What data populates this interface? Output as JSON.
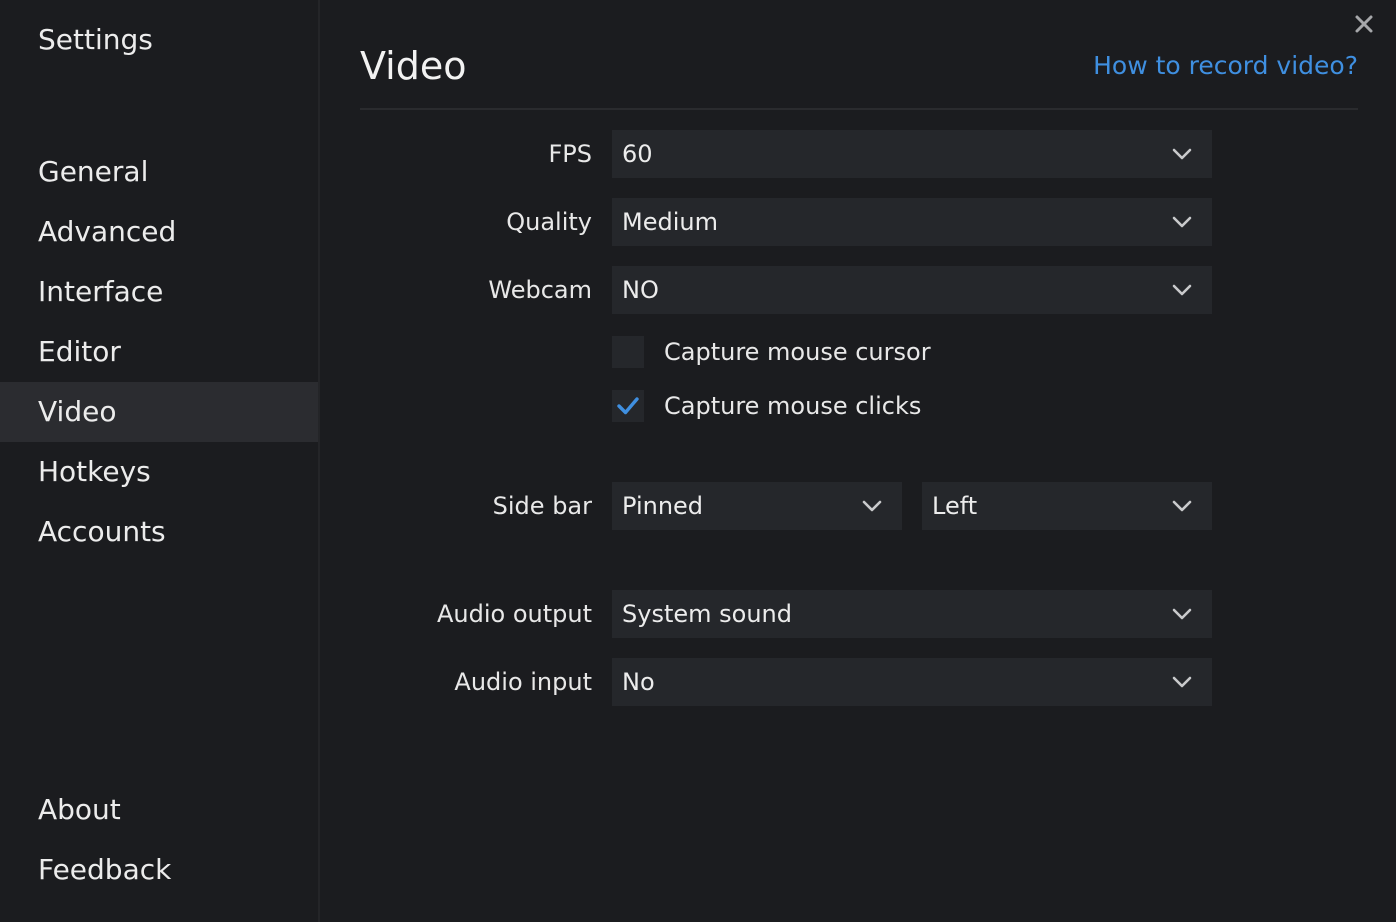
{
  "sidebar": {
    "title": "Settings",
    "items": [
      {
        "label": "General",
        "active": false
      },
      {
        "label": "Advanced",
        "active": false
      },
      {
        "label": "Interface",
        "active": false
      },
      {
        "label": "Editor",
        "active": false
      },
      {
        "label": "Video",
        "active": true
      },
      {
        "label": "Hotkeys",
        "active": false
      },
      {
        "label": "Accounts",
        "active": false
      }
    ],
    "bottom_items": [
      {
        "label": "About"
      },
      {
        "label": "Feedback"
      }
    ]
  },
  "header": {
    "title": "Video",
    "help_link": "How to record video?"
  },
  "form": {
    "fps": {
      "label": "FPS",
      "value": "60"
    },
    "quality": {
      "label": "Quality",
      "value": "Medium"
    },
    "webcam": {
      "label": "Webcam",
      "value": "NO"
    },
    "capture_cursor": {
      "label": "Capture mouse cursor",
      "checked": false
    },
    "capture_clicks": {
      "label": "Capture mouse clicks",
      "checked": true
    },
    "sidebar_mode": {
      "label": "Side bar",
      "value": "Pinned"
    },
    "sidebar_position": {
      "value": "Left"
    },
    "audio_output": {
      "label": "Audio output",
      "value": "System sound"
    },
    "audio_input": {
      "label": "Audio input",
      "value": "No"
    }
  },
  "icons": {
    "close": "close-icon",
    "chevron": "chevron-down-icon",
    "check": "check-icon"
  },
  "colors": {
    "accent": "#3f8fe0",
    "background": "#1b1c1f",
    "field": "#25272b",
    "active_nav": "#2b2c30"
  }
}
